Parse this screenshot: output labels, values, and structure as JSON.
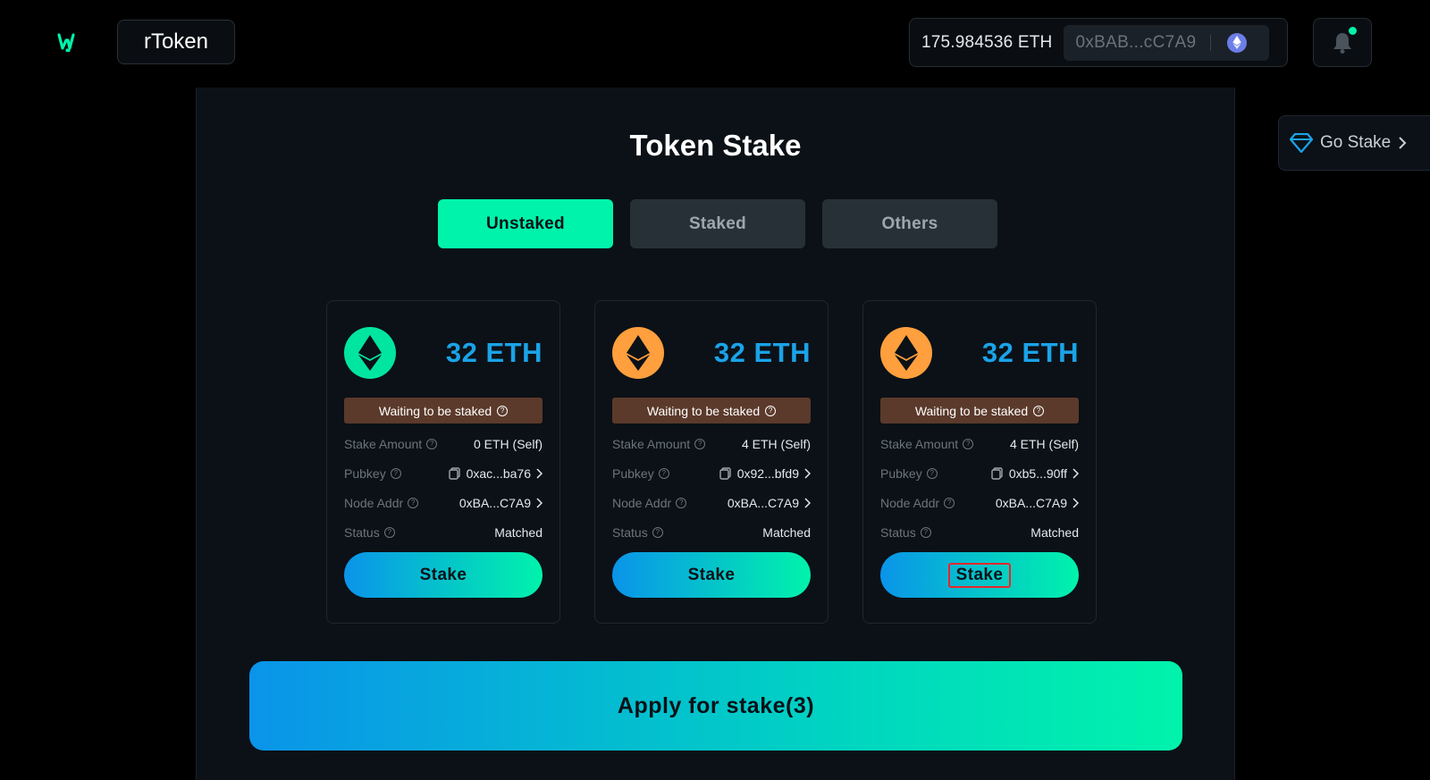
{
  "header": {
    "brand_label": "rToken",
    "wallet_balance": "175.984536 ETH",
    "wallet_address": "0xBAB...cC7A9"
  },
  "sidebar_link": {
    "label": "Go Stake"
  },
  "main": {
    "title": "Token Stake",
    "tabs": [
      {
        "label": "Unstaked",
        "active": true
      },
      {
        "label": "Staked",
        "active": false
      },
      {
        "label": "Others",
        "active": false
      }
    ],
    "labels": {
      "stake_amount": "Stake Amount",
      "pubkey": "Pubkey",
      "node_addr": "Node Addr",
      "status": "Status"
    },
    "cards": [
      {
        "amount": "32 ETH",
        "badge_color": "#00e6a0",
        "banner": "Waiting to be staked",
        "stake_amount": "0 ETH (Self)",
        "pubkey": "0xac...ba76",
        "node_addr": "0xBA...C7A9",
        "status": "Matched",
        "button": "Stake"
      },
      {
        "amount": "32 ETH",
        "badge_color": "#ff9f3d",
        "banner": "Waiting to be staked",
        "stake_amount": "4 ETH (Self)",
        "pubkey": "0x92...bfd9",
        "node_addr": "0xBA...C7A9",
        "status": "Matched",
        "button": "Stake"
      },
      {
        "amount": "32 ETH",
        "badge_color": "#ff9f3d",
        "banner": "Waiting to be staked",
        "stake_amount": "4 ETH (Self)",
        "pubkey": "0xb5...90ff",
        "node_addr": "0xBA...C7A9",
        "status": "Matched",
        "button": "Stake"
      }
    ],
    "apply_button": "Apply for stake(3)"
  },
  "colors": {
    "accent": "#00f3ab",
    "amount_blue": "#1aa3e8",
    "banner_brown": "#5b3a2b",
    "highlight_red": "#e8272b"
  }
}
